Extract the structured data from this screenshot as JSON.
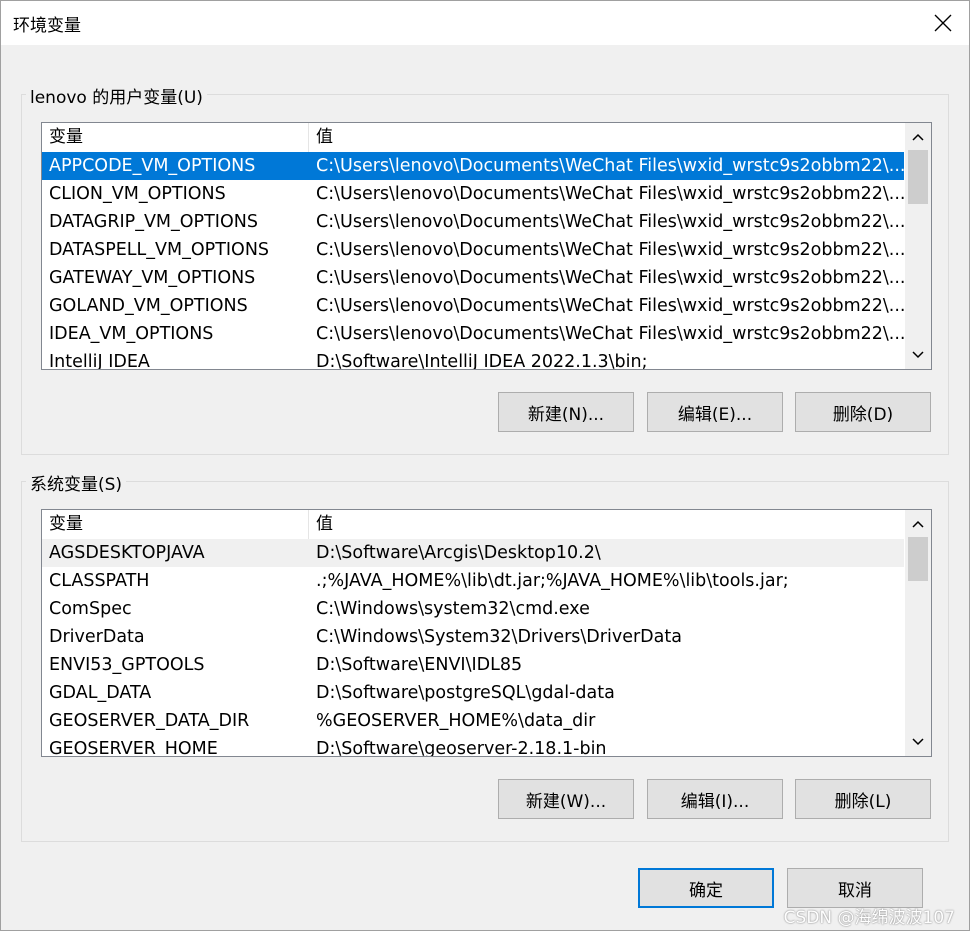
{
  "window": {
    "title": "环境变量"
  },
  "user_group": {
    "label": "lenovo 的用户变量(U)",
    "columns": {
      "name": "变量",
      "value": "值"
    },
    "rows": [
      {
        "name": "APPCODE_VM_OPTIONS",
        "value": "C:\\Users\\lenovo\\Documents\\WeChat Files\\wxid_wrstc9s2obbm22\\..."
      },
      {
        "name": "CLION_VM_OPTIONS",
        "value": "C:\\Users\\lenovo\\Documents\\WeChat Files\\wxid_wrstc9s2obbm22\\..."
      },
      {
        "name": "DATAGRIP_VM_OPTIONS",
        "value": "C:\\Users\\lenovo\\Documents\\WeChat Files\\wxid_wrstc9s2obbm22\\..."
      },
      {
        "name": "DATASPELL_VM_OPTIONS",
        "value": "C:\\Users\\lenovo\\Documents\\WeChat Files\\wxid_wrstc9s2obbm22\\..."
      },
      {
        "name": "GATEWAY_VM_OPTIONS",
        "value": "C:\\Users\\lenovo\\Documents\\WeChat Files\\wxid_wrstc9s2obbm22\\..."
      },
      {
        "name": "GOLAND_VM_OPTIONS",
        "value": "C:\\Users\\lenovo\\Documents\\WeChat Files\\wxid_wrstc9s2obbm22\\..."
      },
      {
        "name": "IDEA_VM_OPTIONS",
        "value": "C:\\Users\\lenovo\\Documents\\WeChat Files\\wxid_wrstc9s2obbm22\\..."
      },
      {
        "name": "IntelliJ IDEA",
        "value": "D:\\Software\\IntelliJ IDEA 2022.1.3\\bin;"
      }
    ],
    "buttons": {
      "new": "新建(N)...",
      "edit": "编辑(E)...",
      "delete": "删除(D)"
    }
  },
  "system_group": {
    "label": "系统变量(S)",
    "columns": {
      "name": "变量",
      "value": "值"
    },
    "rows": [
      {
        "name": "AGSDESKTOPJAVA",
        "value": "D:\\Software\\Arcgis\\Desktop10.2\\"
      },
      {
        "name": "CLASSPATH",
        "value": ".;%JAVA_HOME%\\lib\\dt.jar;%JAVA_HOME%\\lib\\tools.jar;"
      },
      {
        "name": "ComSpec",
        "value": "C:\\Windows\\system32\\cmd.exe"
      },
      {
        "name": "DriverData",
        "value": "C:\\Windows\\System32\\Drivers\\DriverData"
      },
      {
        "name": "ENVI53_GPTOOLS",
        "value": "D:\\Software\\ENVI\\IDL85"
      },
      {
        "name": "GDAL_DATA",
        "value": "D:\\Software\\postgreSQL\\gdal-data"
      },
      {
        "name": "GEOSERVER_DATA_DIR",
        "value": "%GEOSERVER_HOME%\\data_dir"
      },
      {
        "name": "GEOSERVER_HOME",
        "value": "D:\\Software\\geoserver-2.18.1-bin"
      }
    ],
    "buttons": {
      "new": "新建(W)...",
      "edit": "编辑(I)...",
      "delete": "删除(L)"
    }
  },
  "footer": {
    "ok": "确定",
    "cancel": "取消"
  },
  "watermark": "CSDN @海绵波波107",
  "colors": {
    "accent": "#0078d7",
    "window_bg": "#f0f0f0",
    "button_bg": "#e1e1e1"
  }
}
